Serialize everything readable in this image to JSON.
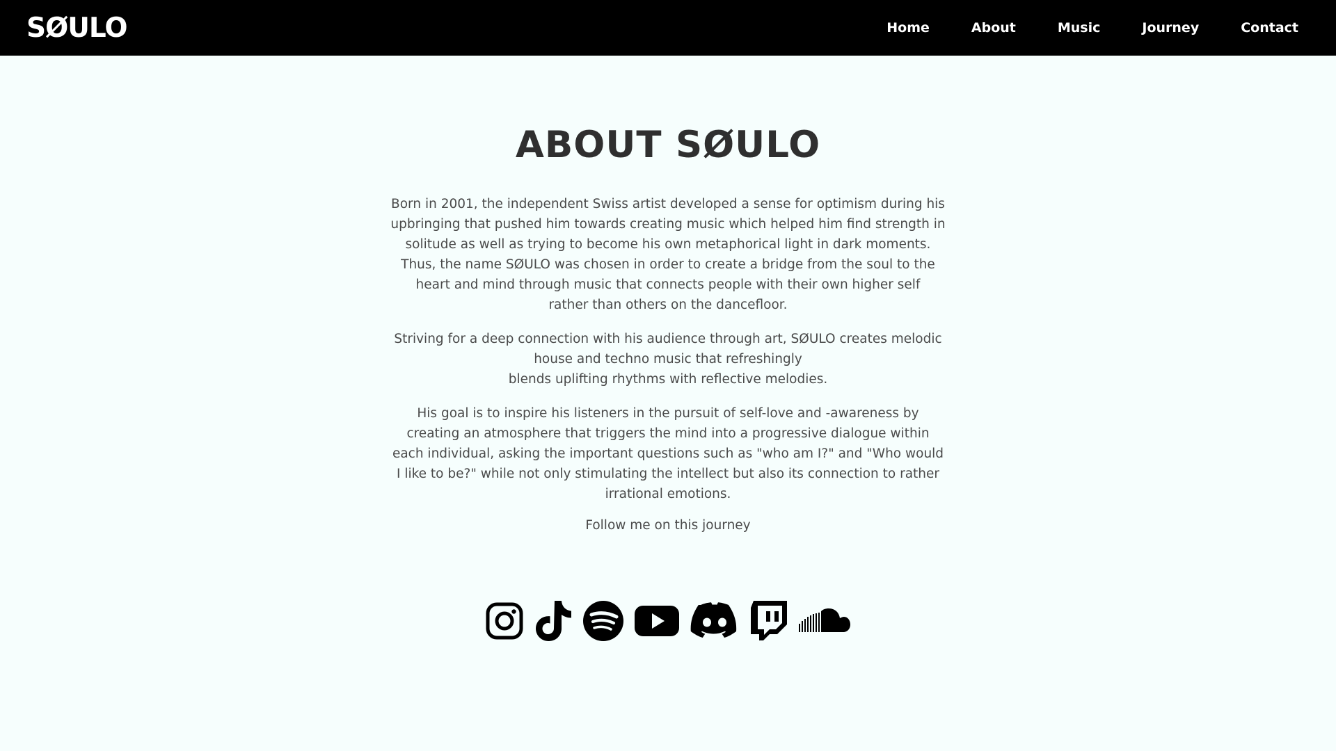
{
  "nav": {
    "logo": "SØULO",
    "links": [
      "Home",
      "About",
      "Music",
      "Journey",
      "Contact"
    ]
  },
  "main": {
    "title": "ABOUT SØULO",
    "paragraphs": [
      "Born in 2001, the independent Swiss artist developed a sense for optimism during his upbringing that pushed him towards creating music which helped him find strength in solitude as well as trying to become his own metaphorical light in dark moments. Thus, the name SØULO was chosen in order to create a bridge from the soul to the heart and mind through music that connects people with their own higher self",
      "rather than others on the dancefloor.",
      "Striving for a deep connection with his audience through art, SØULO creates melodic house and techno music that refreshingly",
      "blends uplifting rhythms with reflective melodies.",
      "His goal is to inspire his listeners in the pursuit of self-love and -awareness by creating an atmosphere that triggers the mind into a progressive dialogue within each individual, asking the important questions such as \"who am I?\" and \"Who would I like to be?\" while not only stimulating the intellect but also its connection to rather irrational emotions."
    ],
    "follow": "Follow me on this journey"
  },
  "socials": [
    "instagram-icon",
    "tiktok-icon",
    "spotify-icon",
    "youtube-icon",
    "discord-icon",
    "twitch-icon",
    "soundcloud-icon"
  ],
  "colors": {
    "navbar": "#000000",
    "background": "#f6fefd",
    "title": "#2f2f2f",
    "text": "#4a4a4a"
  }
}
